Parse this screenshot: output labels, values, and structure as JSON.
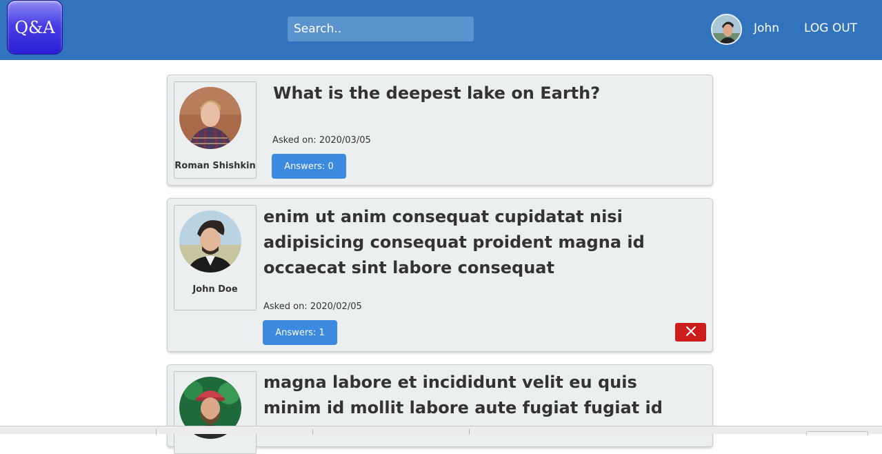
{
  "header": {
    "logo_text": "Q&A",
    "search_placeholder": "Search..",
    "user_name": "John",
    "logout_label": "LOG OUT"
  },
  "questions": [
    {
      "title": "What is the deepest lake on Earth?",
      "author": "Roman Shishkin",
      "asked_on": "Asked on: 2020/03/05",
      "answers_label": "Answers: 0",
      "can_delete": false
    },
    {
      "title": "enim ut anim consequat cupidatat nisi adipisicing consequat proident magna id occaecat sint labore consequat",
      "author": "John Doe",
      "asked_on": "Asked on: 2020/02/05",
      "answers_label": "Answers: 1",
      "can_delete": true
    },
    {
      "title": "magna labore et incididunt velit eu quis minim id mollit labore aute fugiat fugiat id",
      "author": "",
      "asked_on": "",
      "answers_label": "",
      "can_delete": false
    }
  ],
  "colors": {
    "navbar": "#3174bd",
    "answers_button": "#3b8ae0",
    "delete_button": "#cc1c1c",
    "card_background": "#eceff0"
  },
  "icons": {
    "delete": "close-icon"
  }
}
